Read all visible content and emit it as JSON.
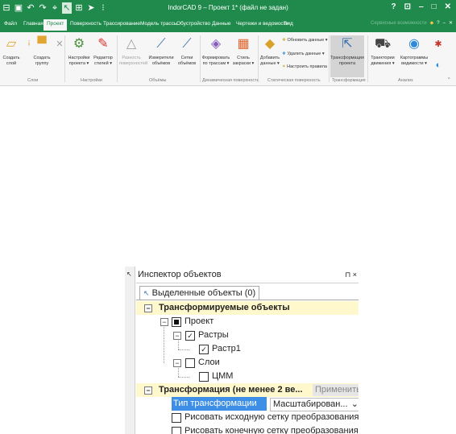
{
  "titlebar": {
    "title": "IndorCAD 9 – Проект 1* (файл не задан)",
    "help": "?",
    "restore": "⊡",
    "minimize": "‒",
    "maximize": "□",
    "close": "✕"
  },
  "tabs": [
    "Файл",
    "Главная",
    "Проект",
    "Поверхность",
    "Трассирование",
    "Модель трассы",
    "Обустройство",
    "Данные",
    "Чертежи и ведомости",
    "Вид"
  ],
  "tab_right": {
    "label": "Сервисные возможности",
    "help": "?",
    "min": "‒",
    "close": "✕"
  },
  "ribbon": {
    "buttons": [
      {
        "label1": "Создать",
        "label2": "слой"
      },
      {
        "label1": "Создать",
        "label2": "группу"
      },
      {
        "label1": "Настройки",
        "label2": "проекта ▾"
      },
      {
        "label1": "Редактор",
        "label2": "стилей ▾"
      },
      {
        "label1": "Разность",
        "label2": "поверхностей"
      },
      {
        "label1": "Измерители",
        "label2": "объёмов"
      },
      {
        "label1": "Сетки",
        "label2": "объёмов"
      },
      {
        "label1": "Формировать",
        "label2": "по трассам ▾"
      },
      {
        "label1": "Стиль",
        "label2": "закраски ▾"
      },
      {
        "label1": "Добавить",
        "label2": "данные ▾"
      },
      {
        "label1": "Трансформация",
        "label2": "проекта"
      },
      {
        "label1": "Траектории",
        "label2": "движения ▾"
      },
      {
        "label1": "Картограммы",
        "label2": "видимости ▾"
      }
    ],
    "small_buttons": [
      "Обновить данные ▾",
      "Удалить данные ▾",
      "Настроить правила"
    ],
    "groups": [
      "Слои",
      "Настройки",
      "Объёмы",
      "Динамическая поверхность",
      "Статическая поверхность",
      "Трансформация",
      "Анализ"
    ],
    "collapse": "^"
  },
  "inspector": {
    "title": "Инспектор объектов",
    "pin": "⊓",
    "close": "×",
    "tab": "Выделенные объекты (0)",
    "cat1": "Трансформируемые объекты",
    "project": "Проект",
    "rasters": "Растры",
    "raster1": "Растр1",
    "layers": "Слои",
    "cmm": "ЦММ",
    "cat2": "Трансформация (не менее 2 ве...",
    "apply": "Применить",
    "transform_type_label": "Тип трансформации",
    "transform_type_value": "Масштабирован...",
    "draw_src_grid": "Рисовать исходную сетку преобразования",
    "draw_dst_grid": "Рисовать конечную сетку преобразования",
    "minus": "−",
    "check": "✓",
    "arrow": "⌄"
  },
  "colors": {
    "accent": "#1f8a4c",
    "category_bg": "#fff8cc",
    "selection": "#3c8ee6"
  }
}
